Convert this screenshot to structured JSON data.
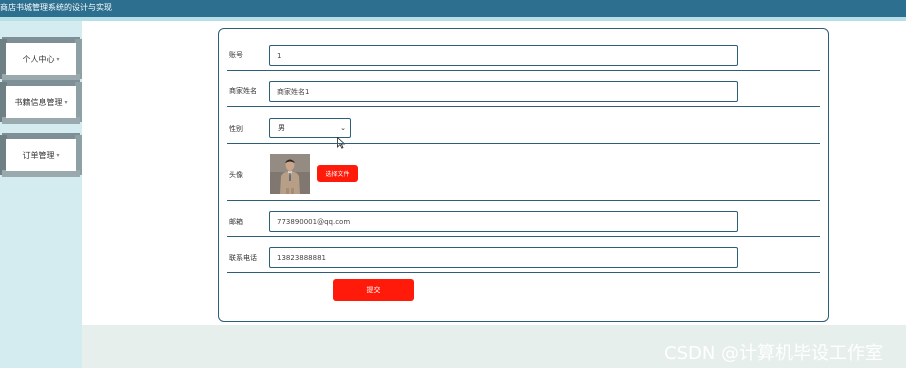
{
  "header": {
    "title": "商店书城管理系统的设计与实现"
  },
  "sidebar": {
    "items": [
      {
        "label": "个人中心"
      },
      {
        "label": "书籍信息管理"
      },
      {
        "label": "订单管理"
      }
    ]
  },
  "form": {
    "account": {
      "label": "账号",
      "value": "1"
    },
    "merchant_name": {
      "label": "商家姓名",
      "value": "商家姓名1"
    },
    "gender": {
      "label": "性别",
      "value": "男"
    },
    "avatar": {
      "label": "头像",
      "file_button": "选择文件"
    },
    "email": {
      "label": "邮箱",
      "value": "773890001@qq.com"
    },
    "phone": {
      "label": "联系电话",
      "value": "13823888881"
    },
    "submit_label": "提交"
  },
  "watermark": "CSDN @计算机毕设工作室",
  "colors": {
    "header": "#2c6f8f",
    "accent": "#ff1a0a",
    "border": "#2e5f78"
  }
}
